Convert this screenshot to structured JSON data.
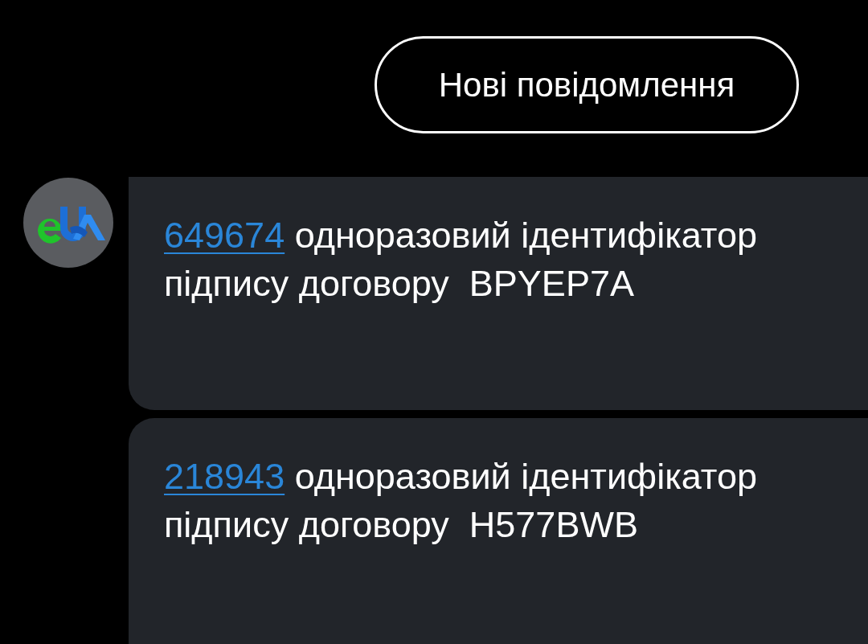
{
  "header": {
    "new_messages_button": "Нові повідомлення"
  },
  "messages": [
    {
      "code": "649674",
      "text": "одноразовий ідентифікатор підпису договору  BPYEP7A"
    },
    {
      "code": "218943",
      "text": "одноразовий ідентифікатор підпису договору  H577BWB"
    }
  ]
}
